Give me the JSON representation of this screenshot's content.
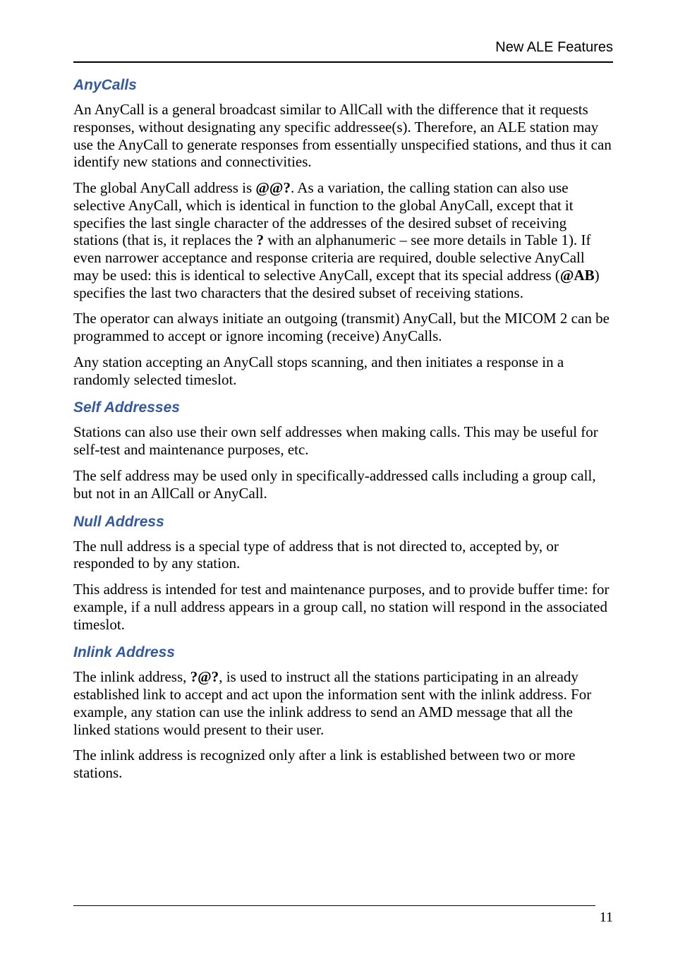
{
  "header": {
    "title": "New ALE Features"
  },
  "sections": {
    "anycalls": {
      "heading": "AnyCalls",
      "p1_a": "An AnyCall is a general broadcast similar to AllCall with the difference that it requests responses, without designating any specific addressee(s). Therefore, an ALE station may use the AnyCall to generate responses from essentially unspecified stations, and thus it can identify new stations and connectivities.",
      "p2_a": "The global AnyCall address is ",
      "p2_addr1": "@@?",
      "p2_b": ". As a variation, the calling station can also use selective AnyCall, which is identical in function to the global AnyCall, except that it specifies the last single character of the addresses of the desired subset of receiving stations (that is, it replaces the ",
      "p2_q": "?",
      "p2_c": " with an alphanumeric – see more details in Table 1). If even narrower acceptance and response criteria are required, double selective AnyCall may be used: this is identical to selective AnyCall, except that its special address (",
      "p2_addr2": "@AB",
      "p2_d": ") specifies the last two characters that the desired subset of receiving stations.",
      "p3": "The operator can always initiate an outgoing (transmit) AnyCall, but the MICOM 2 can be programmed to accept or ignore incoming (receive) AnyCalls.",
      "p4": "Any station accepting an AnyCall stops scanning, and then initiates a response in a randomly selected timeslot."
    },
    "self": {
      "heading": "Self Addresses",
      "p1": "Stations can also use their own self addresses when making calls. This may be useful for self-test and maintenance purposes, etc.",
      "p2": "The self address may be used only in specifically-addressed calls including a group call, but not in an AllCall or AnyCall."
    },
    "null": {
      "heading": "Null Address",
      "p1": "The null address is a special type of address that is not directed to, accepted by, or responded to by any station.",
      "p2": "This address is intended for test and maintenance purposes, and to provide buffer time: for example, if a null address appears in a group call, no station will respond in the associated timeslot."
    },
    "inlink": {
      "heading": "Inlink Address",
      "p1_a": "The inlink address, ",
      "p1_addr": "?@?",
      "p1_b": ", is used to instruct all the stations participating in an already established link to accept and act upon the information sent with the inlink address. For example, any station can use the inlink address to send an AMD message that all the linked stations would present to their user.",
      "p2": "The inlink address is recognized only after a link is established between two or more stations."
    }
  },
  "footer": {
    "page": "11"
  }
}
